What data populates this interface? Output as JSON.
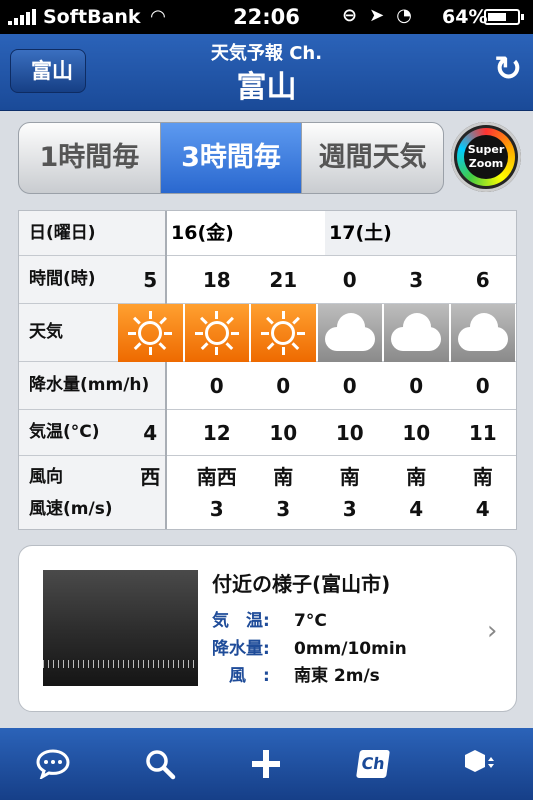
{
  "status": {
    "carrier": "SoftBank",
    "time": "22:06",
    "battery": "64%",
    "battery_level": 0.64
  },
  "nav": {
    "back": "富山",
    "subtitle": "天気予報 Ch.",
    "title": "富山"
  },
  "segments": [
    {
      "label": "1時間毎",
      "active": false
    },
    {
      "label": "3時間毎",
      "active": true
    },
    {
      "label": "週間天気",
      "active": false
    }
  ],
  "superzoom": {
    "line1": "Super",
    "line2": "Zoom"
  },
  "table": {
    "row_labels": {
      "date": "日(曜日)",
      "time": "時間(時)",
      "weather": "天気",
      "precip": "降水量(mm/h)",
      "temp": "気温(°C)",
      "wind_dir": "風向",
      "wind_speed": "風速(m/s)"
    },
    "days": [
      {
        "label": "16(金)"
      },
      {
        "label": "17(土)"
      }
    ],
    "columns": [
      {
        "time": "5",
        "weather": "sunny",
        "precip": "",
        "temp": "4",
        "wind_dir": "西",
        "wind_speed": ""
      },
      {
        "time": "18",
        "weather": "sunny",
        "precip": "0",
        "temp": "12",
        "wind_dir": "南西",
        "wind_speed": "3"
      },
      {
        "time": "21",
        "weather": "sunny",
        "precip": "0",
        "temp": "10",
        "wind_dir": "南",
        "wind_speed": "3"
      },
      {
        "time": "0",
        "weather": "cloudy",
        "precip": "0",
        "temp": "10",
        "wind_dir": "南",
        "wind_speed": "3"
      },
      {
        "time": "3",
        "weather": "cloudy",
        "precip": "0",
        "temp": "10",
        "wind_dir": "南",
        "wind_speed": "4"
      },
      {
        "time": "6",
        "weather": "cloudy",
        "precip": "0",
        "temp": "11",
        "wind_dir": "南",
        "wind_speed": "4"
      }
    ]
  },
  "nearby": {
    "title": "付近の様子(富山市)",
    "temp_label": "気　温:",
    "temp_value": "7°C",
    "precip_label": "降水量:",
    "precip_value": "0mm/10min",
    "wind_label": "　風　:",
    "wind_value": "南東 2m/s"
  },
  "tabbar": [
    {
      "icon": "chat-bubble-icon"
    },
    {
      "icon": "search-icon"
    },
    {
      "icon": "plus-icon"
    },
    {
      "icon": "channel-icon",
      "text": "Ch"
    },
    {
      "icon": "settings-hexagon-icon"
    }
  ]
}
